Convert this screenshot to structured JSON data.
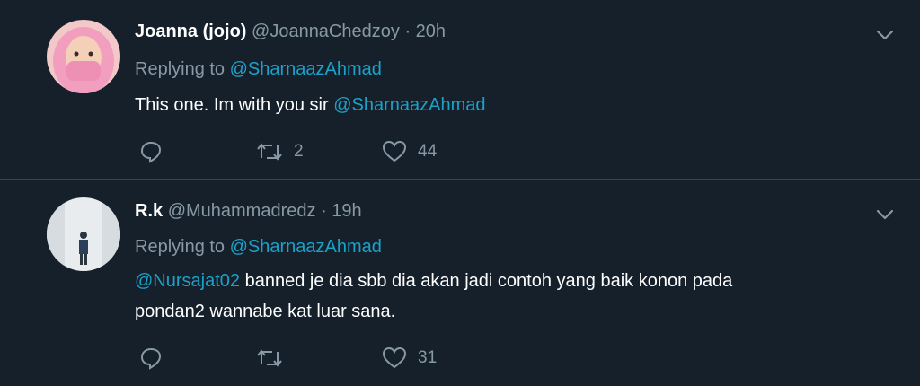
{
  "tweets": [
    {
      "name": "Joanna (jojo)",
      "handle": "@JoannaChedzoy",
      "separator": "·",
      "time": "20h",
      "replying_prefix": "Replying to",
      "replying_to": "@SharnaazAhmad",
      "text_before": "This one. Im with you sir ",
      "text_mention": "@SharnaazAhmad",
      "retweets": "2",
      "likes": "44"
    },
    {
      "name": "R.k",
      "handle": "@Muhammadredz",
      "separator": "·",
      "time": "19h",
      "replying_prefix": "Replying to",
      "replying_to": "@SharnaazAhmad",
      "text_mention": "@Nursajat02",
      "text_line1": " banned je dia sbb dia akan jadi contoh yang baik konon pada",
      "text_line2": "pondan2 wannabe kat luar sana.",
      "retweets": "",
      "likes": "31"
    }
  ],
  "colors": {
    "background": "#15202b",
    "mention": "#1ca1c9",
    "muted": "#8899a6",
    "divider": "#38444d"
  }
}
